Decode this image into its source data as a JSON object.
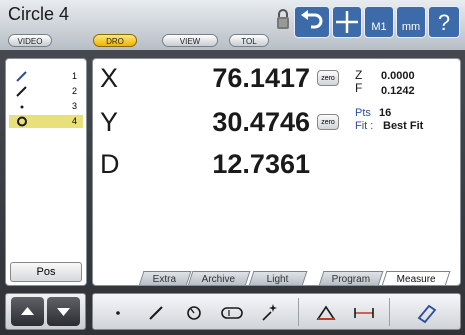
{
  "title": "Circle 4",
  "mode_tabs": [
    "VIDEO",
    "DRO",
    "VIEW",
    "TOL"
  ],
  "mode_active": "DRO",
  "top_buttons": {
    "m1": "M1",
    "units": "mm",
    "help": "?"
  },
  "features": [
    {
      "num": "1",
      "icon": "line-icon"
    },
    {
      "num": "2",
      "icon": "line-icon"
    },
    {
      "num": "3",
      "icon": "point-icon"
    },
    {
      "num": "4",
      "icon": "circle-icon"
    }
  ],
  "selected_feature": "4",
  "pos_label": "Pos",
  "dro": {
    "x_label": "X",
    "x_value": "76.1417",
    "y_label": "Y",
    "y_value": "30.4746",
    "d_label": "D",
    "d_value": "12.7361",
    "zero_label": "zero"
  },
  "side_info": {
    "z_label": "Z",
    "z_value": "0.0000",
    "f_label": "F",
    "f_value": "0.1242",
    "pts_label": "Pts",
    "pts_value": "16",
    "fit_label": "Fit :",
    "fit_value": "Best Fit"
  },
  "bottom_tabs": [
    "Extra",
    "Archive",
    "Light",
    "Program",
    "Measure"
  ],
  "bottom_tab_active": "Measure",
  "colors": {
    "accent": "#3d6aa8",
    "highlight": "#e8e07a",
    "active_tab": "#f0b400"
  }
}
